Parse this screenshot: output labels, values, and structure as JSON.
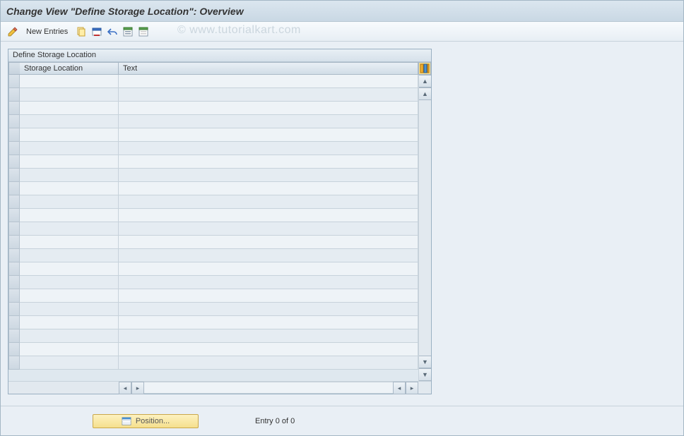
{
  "title": "Change View \"Define Storage Location\": Overview",
  "watermark": "© www.tutorialkart.com",
  "toolbar": {
    "new_entries_label": "New Entries"
  },
  "panel": {
    "title": "Define Storage Location",
    "columns": {
      "c1": "Storage Location",
      "c2": "Text"
    },
    "rows": [
      {
        "storage_location": "",
        "text": ""
      },
      {
        "storage_location": "",
        "text": ""
      },
      {
        "storage_location": "",
        "text": ""
      },
      {
        "storage_location": "",
        "text": ""
      },
      {
        "storage_location": "",
        "text": ""
      },
      {
        "storage_location": "",
        "text": ""
      },
      {
        "storage_location": "",
        "text": ""
      },
      {
        "storage_location": "",
        "text": ""
      },
      {
        "storage_location": "",
        "text": ""
      },
      {
        "storage_location": "",
        "text": ""
      },
      {
        "storage_location": "",
        "text": ""
      },
      {
        "storage_location": "",
        "text": ""
      },
      {
        "storage_location": "",
        "text": ""
      },
      {
        "storage_location": "",
        "text": ""
      },
      {
        "storage_location": "",
        "text": ""
      },
      {
        "storage_location": "",
        "text": ""
      },
      {
        "storage_location": "",
        "text": ""
      },
      {
        "storage_location": "",
        "text": ""
      },
      {
        "storage_location": "",
        "text": ""
      },
      {
        "storage_location": "",
        "text": ""
      },
      {
        "storage_location": "",
        "text": ""
      },
      {
        "storage_location": "",
        "text": ""
      }
    ]
  },
  "footer": {
    "position_label": "Position...",
    "status": "Entry 0 of 0"
  }
}
